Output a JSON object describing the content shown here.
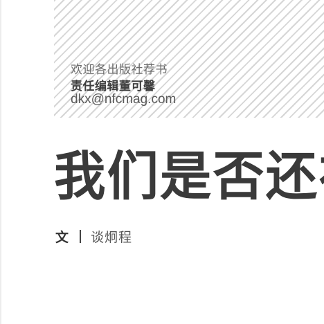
{
  "masthead": {
    "welcome": "欢迎各出版社荐书",
    "editor": "责任编辑董可馨",
    "email": "dkx@nfcmag.com"
  },
  "article": {
    "headline": "我们是否还在深",
    "byline_label": "文",
    "byline_author": "谈炯程"
  }
}
